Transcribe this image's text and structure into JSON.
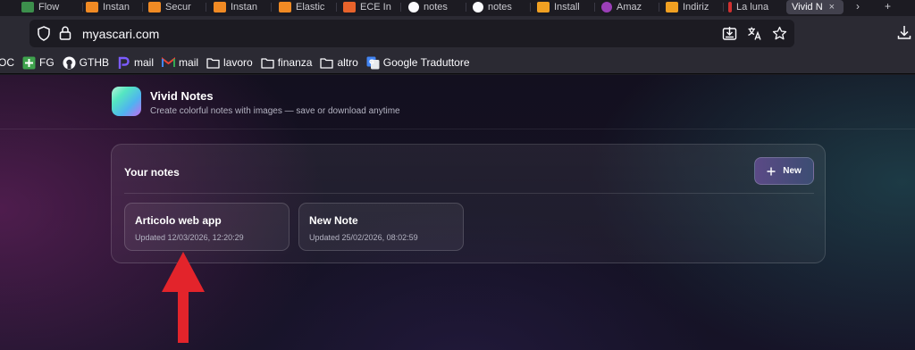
{
  "browser": {
    "tabs": [
      {
        "label": "Flow",
        "fav_color": "#3c8f4c",
        "fav_text": ""
      },
      {
        "label": "Instan",
        "fav_color": "#f08a24",
        "fav_text": ""
      },
      {
        "label": "Secur",
        "fav_color": "#f08a24",
        "fav_text": ""
      },
      {
        "label": "Instan",
        "fav_color": "#f08a24",
        "fav_text": ""
      },
      {
        "label": "Elastic",
        "fav_color": "#f08a24",
        "fav_text": ""
      },
      {
        "label": "ECE In",
        "fav_color": "#e8632b",
        "fav_text": ""
      },
      {
        "label": "notes",
        "fav_color": "#24292f",
        "fav_text": ""
      },
      {
        "label": "notes",
        "fav_color": "#24292f",
        "fav_text": ""
      },
      {
        "label": "Install",
        "fav_color": "#f0a022",
        "fav_text": ""
      },
      {
        "label": "Amaz",
        "fav_color": "#9b3fb8",
        "fav_text": ""
      },
      {
        "label": "Indiriz",
        "fav_color": "#f0a022",
        "fav_text": ""
      },
      {
        "label": "La luna",
        "fav_color": "#d03030",
        "fav_text": ""
      }
    ],
    "active_tab": {
      "label": "Vivid N",
      "close": "×"
    },
    "url": "myascari.com",
    "bookmarks": [
      {
        "label": "OC",
        "icon": "none",
        "color": ""
      },
      {
        "label": "FG",
        "icon": "plus-square-icon",
        "color": "#3fa34d"
      },
      {
        "label": "GTHB",
        "icon": "github-icon",
        "color": "#fbfbfe"
      },
      {
        "label": "mail",
        "icon": "p-logo-icon",
        "color": "#7c5cff"
      },
      {
        "label": "mail",
        "icon": "gmail-icon",
        "color": "#ea4335"
      },
      {
        "label": "lavoro",
        "icon": "folder-icon",
        "color": "#fbfbfe"
      },
      {
        "label": "finanza",
        "icon": "folder-icon",
        "color": "#fbfbfe"
      },
      {
        "label": "altro",
        "icon": "folder-icon",
        "color": "#fbfbfe"
      },
      {
        "label": "Google Traduttore",
        "icon": "google-translate-icon",
        "color": "#4285f4"
      }
    ]
  },
  "app": {
    "title": "Vivid Notes",
    "subtitle": "Create colorful notes with images — save or download anytime"
  },
  "notes_panel": {
    "title": "Your notes",
    "new_button_label": "New",
    "notes": [
      {
        "title": "Articolo web app",
        "updated": "Updated 12/03/2026, 12:20:29"
      },
      {
        "title": "New Note",
        "updated": "Updated 25/02/2026, 08:02:59"
      }
    ]
  },
  "annotation": {
    "arrow_color": "#e3242b"
  }
}
